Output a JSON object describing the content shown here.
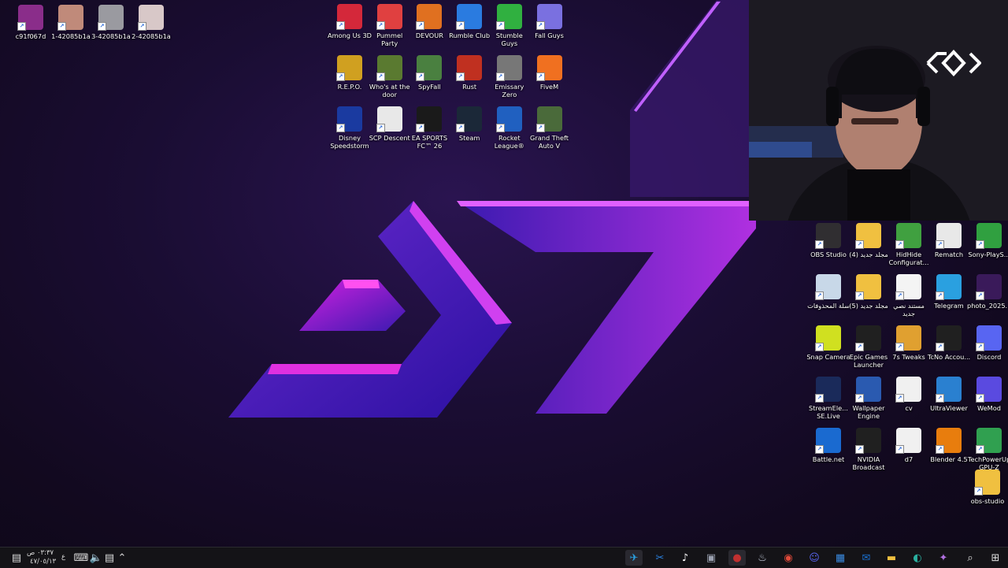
{
  "desktop": {
    "top_left_icons": [
      {
        "label": "c91f067d",
        "icon": "winrar-archive-icon",
        "color": "#8a2d8a"
      },
      {
        "label": "1-42085b1a",
        "icon": "photo-thumbnail-icon",
        "color": "#c08a7a"
      },
      {
        "label": "3-42085b1a",
        "icon": "photo-thumbnail-icon",
        "color": "#9a9aa0"
      },
      {
        "label": "2-42085b1a",
        "icon": "photo-thumbnail-icon",
        "color": "#d8c8c8"
      }
    ],
    "center_icons": [
      {
        "label": "Among Us 3D",
        "icon": "among-us-icon",
        "color": "#d4283a"
      },
      {
        "label": "Pummel Party",
        "icon": "pummel-party-icon",
        "color": "#e04040"
      },
      {
        "label": "DEVOUR",
        "icon": "devour-icon",
        "color": "#e07020"
      },
      {
        "label": "Rumble Club",
        "icon": "rumble-club-icon",
        "color": "#2a7be0"
      },
      {
        "label": "Stumble Guys",
        "icon": "stumble-guys-icon",
        "color": "#30b040"
      },
      {
        "label": "Fall Guys",
        "icon": "fall-guys-icon",
        "color": "#7a70e0"
      },
      {
        "label": "R.E.P.O.",
        "icon": "repo-icon",
        "color": "#d0a020"
      },
      {
        "label": "Who's at the door",
        "icon": "whos-at-the-door-icon",
        "color": "#5a7a30"
      },
      {
        "label": "SpyFall",
        "icon": "spyfall-icon",
        "color": "#4a8040"
      },
      {
        "label": "Rust",
        "icon": "rust-icon",
        "color": "#c03020"
      },
      {
        "label": "Emissary Zero",
        "icon": "emissary-zero-icon",
        "color": "#777777"
      },
      {
        "label": "FiveM",
        "icon": "fivem-icon",
        "color": "#f07020"
      },
      {
        "label": "Disney Speedstorm",
        "icon": "disney-speedstorm-icon",
        "color": "#1a3aa0"
      },
      {
        "label": "SCP Descent",
        "icon": "scp-descent-icon",
        "color": "#e8e8e8"
      },
      {
        "label": "EA SPORTS FC™ 26",
        "icon": "ea-sports-fc-icon",
        "color": "#1a1a1a"
      },
      {
        "label": "Steam",
        "icon": "steam-icon",
        "color": "#1b2838"
      },
      {
        "label": "Rocket League®",
        "icon": "rocket-league-icon",
        "color": "#2060c0"
      },
      {
        "label": "Grand Theft Auto V",
        "icon": "gta-v-icon",
        "color": "#4a6a3a"
      }
    ],
    "right_icons": [
      {
        "label": "OBS Studio",
        "icon": "obs-studio-icon",
        "color": "#302e31"
      },
      {
        "label": "مجلد جديد (4)",
        "icon": "folder-icon",
        "color": "#f0c040"
      },
      {
        "label": "HidHide Configurat...",
        "icon": "hidhide-icon",
        "color": "#40a040"
      },
      {
        "label": "Rematch",
        "icon": "rematch-icon",
        "color": "#e8e8e8"
      },
      {
        "label": "Sony-PlayS...",
        "icon": "playstation-icon",
        "color": "#30a040"
      },
      {
        "label": "سلة المحذوفات",
        "icon": "recycle-bin-icon",
        "color": "#c8d8e8"
      },
      {
        "label": "مجلد جديد (5)",
        "icon": "folder-icon",
        "color": "#f0c040"
      },
      {
        "label": "مستند نصي جديد",
        "icon": "text-document-icon",
        "color": "#f4f4f4"
      },
      {
        "label": "Telegram",
        "icon": "telegram-icon",
        "color": "#2aa0e0"
      },
      {
        "label": "photo_2025...",
        "icon": "photo-thumbnail-icon",
        "color": "#3a1a5a"
      },
      {
        "label": "Snap Camera",
        "icon": "snap-camera-icon",
        "color": "#d0e020"
      },
      {
        "label": "Epic Games Launcher",
        "icon": "epic-games-icon",
        "color": "#202020"
      },
      {
        "label": "7s Tweaks",
        "icon": "7s-tweaks-icon",
        "color": "#e0a030"
      },
      {
        "label": "TcNo Accou...",
        "icon": "tcno-icon",
        "color": "#202020"
      },
      {
        "label": "Discord",
        "icon": "discord-icon",
        "color": "#5865f2"
      },
      {
        "label": "StreamEle... SE.Live",
        "icon": "streamelements-icon",
        "color": "#1a2a5a"
      },
      {
        "label": "Wallpaper Engine",
        "icon": "wallpaper-engine-icon",
        "color": "#2a5ab0"
      },
      {
        "label": "cv",
        "icon": "document-icon",
        "color": "#f0f0f0"
      },
      {
        "label": "UltraViewer",
        "icon": "ultraviewer-icon",
        "color": "#2a80d0"
      },
      {
        "label": "WeMod",
        "icon": "wemod-icon",
        "color": "#5a4ae0"
      },
      {
        "label": "Battle.net",
        "icon": "battlenet-icon",
        "color": "#1a6ad0"
      },
      {
        "label": "NVIDIA Broadcast",
        "icon": "nvidia-broadcast-icon",
        "color": "#202020"
      },
      {
        "label": "d7",
        "icon": "document-icon",
        "color": "#f0f0f0"
      },
      {
        "label": "Blender 4.5",
        "icon": "blender-icon",
        "color": "#e87d0d"
      },
      {
        "label": "TechPowerUp GPU-Z",
        "icon": "gpu-z-icon",
        "color": "#30a050"
      },
      {
        "label": "obs-studio",
        "icon": "folder-icon",
        "color": "#f0c040"
      }
    ]
  },
  "taskbar": {
    "clock_time": "٠٣:٣٧ ص",
    "clock_date": "٤٧/٠٥/١٣",
    "language": "ع",
    "tray_icons": [
      "notification-icon",
      "keyboard-icon",
      "volume-icon",
      "network-icon",
      "chevron-up-icon"
    ],
    "apps": [
      {
        "name": "telegram-taskbar-icon",
        "color": "#2aa0e0"
      },
      {
        "name": "snipping-tool-taskbar-icon",
        "color": "#2a80e0"
      },
      {
        "name": "tiktok-taskbar-icon",
        "color": "#ffffff"
      },
      {
        "name": "app-taskbar-icon",
        "color": "#9aa0b0"
      },
      {
        "name": "obs-taskbar-icon",
        "color": "#c03030"
      },
      {
        "name": "steam-taskbar-icon",
        "color": "#c8d0e0"
      },
      {
        "name": "chrome-taskbar-icon",
        "color": "#e04a3a"
      },
      {
        "name": "discord-app-taskbar-icon",
        "color": "#5865f2"
      },
      {
        "name": "store-taskbar-icon",
        "color": "#3a8ae0"
      },
      {
        "name": "outlook-taskbar-icon",
        "color": "#1a70d0"
      },
      {
        "name": "file-explorer-taskbar-icon",
        "color": "#f0c040"
      },
      {
        "name": "edge-taskbar-icon",
        "color": "#2ab0a0"
      },
      {
        "name": "copilot-taskbar-icon",
        "color": "#b070e0"
      },
      {
        "name": "search-icon",
        "color": "#e0e0e0"
      },
      {
        "name": "start-button-icon",
        "color": "#e0e0e0"
      }
    ]
  },
  "webcam": {
    "overlay_logo": "brand-logo-icon"
  }
}
